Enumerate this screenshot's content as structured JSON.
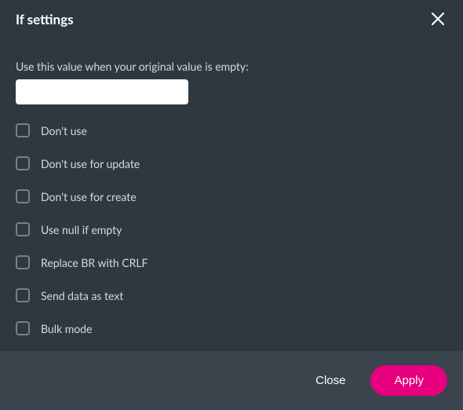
{
  "header": {
    "title": "If settings"
  },
  "form": {
    "default_value_label": "Use this value when your original value is empty:",
    "default_value": "",
    "options": [
      {
        "label": "Don't use",
        "checked": false
      },
      {
        "label": "Don't use for update",
        "checked": false
      },
      {
        "label": "Don't use for create",
        "checked": false
      },
      {
        "label": "Use null if empty",
        "checked": false
      },
      {
        "label": "Replace BR with CRLF",
        "checked": false
      },
      {
        "label": "Send data as text",
        "checked": false
      },
      {
        "label": "Bulk mode",
        "checked": false
      }
    ]
  },
  "footer": {
    "close_label": "Close",
    "apply_label": "Apply"
  }
}
